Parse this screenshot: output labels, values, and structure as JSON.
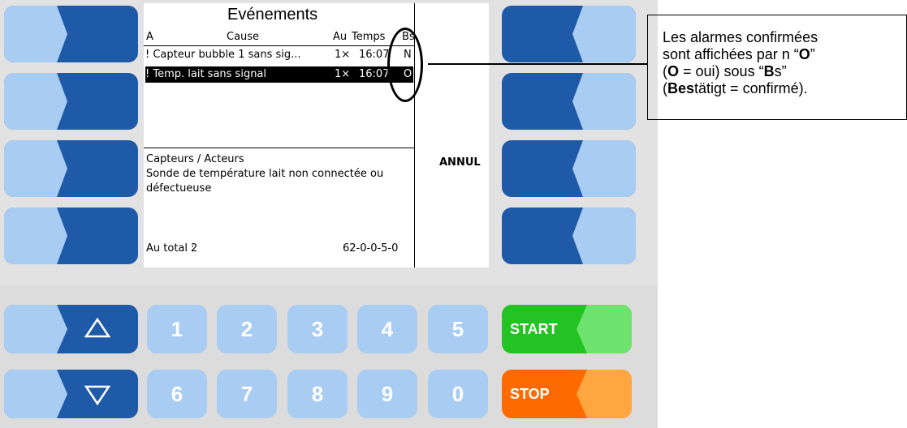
{
  "screen": {
    "title": "Evénements",
    "columns": {
      "a": "A",
      "cause": "Cause",
      "au": "Au",
      "temps": "Temps",
      "bs": "Bs"
    },
    "rows": [
      {
        "cause": "! Capteur bubble 1 sans sig...",
        "count": "1×",
        "time": "16:07",
        "bs": "N",
        "selected": false
      },
      {
        "cause": "! Temp. lait sans signal",
        "count": "1×",
        "time": "16:07",
        "bs": "O",
        "selected": true
      }
    ],
    "detail_category": "Capteurs / Acteurs",
    "detail_line1": "Sonde de température lait non connectée ou",
    "detail_line2": "défectueuse",
    "total_label": "Au total :",
    "total_value": "2",
    "code": "62-0-0-5-0",
    "annul_label": "ANNUL"
  },
  "keypad": {
    "up_icon": "triangle-up-icon",
    "down_icon": "triangle-down-icon",
    "digits_top": [
      "1",
      "2",
      "3",
      "4",
      "5"
    ],
    "digits_bottom": [
      "6",
      "7",
      "8",
      "9",
      "0"
    ],
    "start_label": "START",
    "stop_label": "STOP"
  },
  "callout": {
    "line1": "Les alarmes confirmées",
    "line2_a": "sont affichées par n “",
    "line2_b": "O",
    "line2_c": "”",
    "line3_a": "(",
    "line3_b": "O",
    "line3_c": " = oui) sous “",
    "line3_d": "B",
    "line3_e": "s”",
    "line4_a": "(",
    "line4_b": "Bes",
    "line4_c": "tätigt = confirmé)."
  },
  "colors": {
    "key_dark_blue": "#1e5aa8",
    "key_light_blue": "#a9ccf2",
    "start_green": "#22c322",
    "start_green_light": "#6ee36e",
    "stop_orange": "#ff6a00",
    "stop_orange_light": "#ffa640"
  }
}
